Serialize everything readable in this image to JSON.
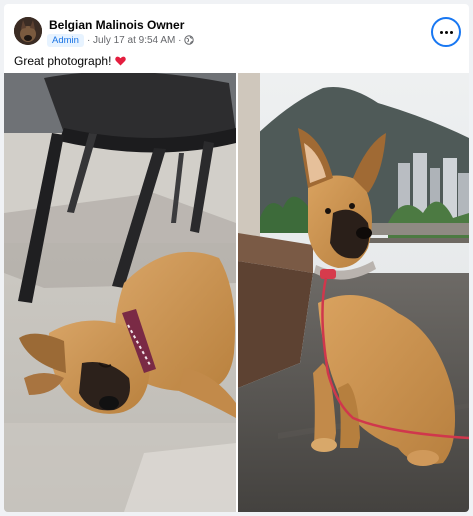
{
  "post": {
    "author": "Belgian Malinois Owner",
    "role_badge": "Admin",
    "timestamp": "· July 17 at 9:54 AM ·",
    "caption": "Great photograph!"
  },
  "icons": {
    "avatar": "dog-avatar",
    "privacy": "globe-icon",
    "more": "more-options-icon",
    "caption_emoji": "heart-icon"
  },
  "colors": {
    "accent": "#1877f2",
    "badge_text": "#1b74e4",
    "badge_bg": "#e7f3ff",
    "heart": "#e41e3f"
  },
  "photos": [
    {
      "subject": "puppy-sleeping-under-chair"
    },
    {
      "subject": "puppy-sitting-on-promenade"
    }
  ]
}
